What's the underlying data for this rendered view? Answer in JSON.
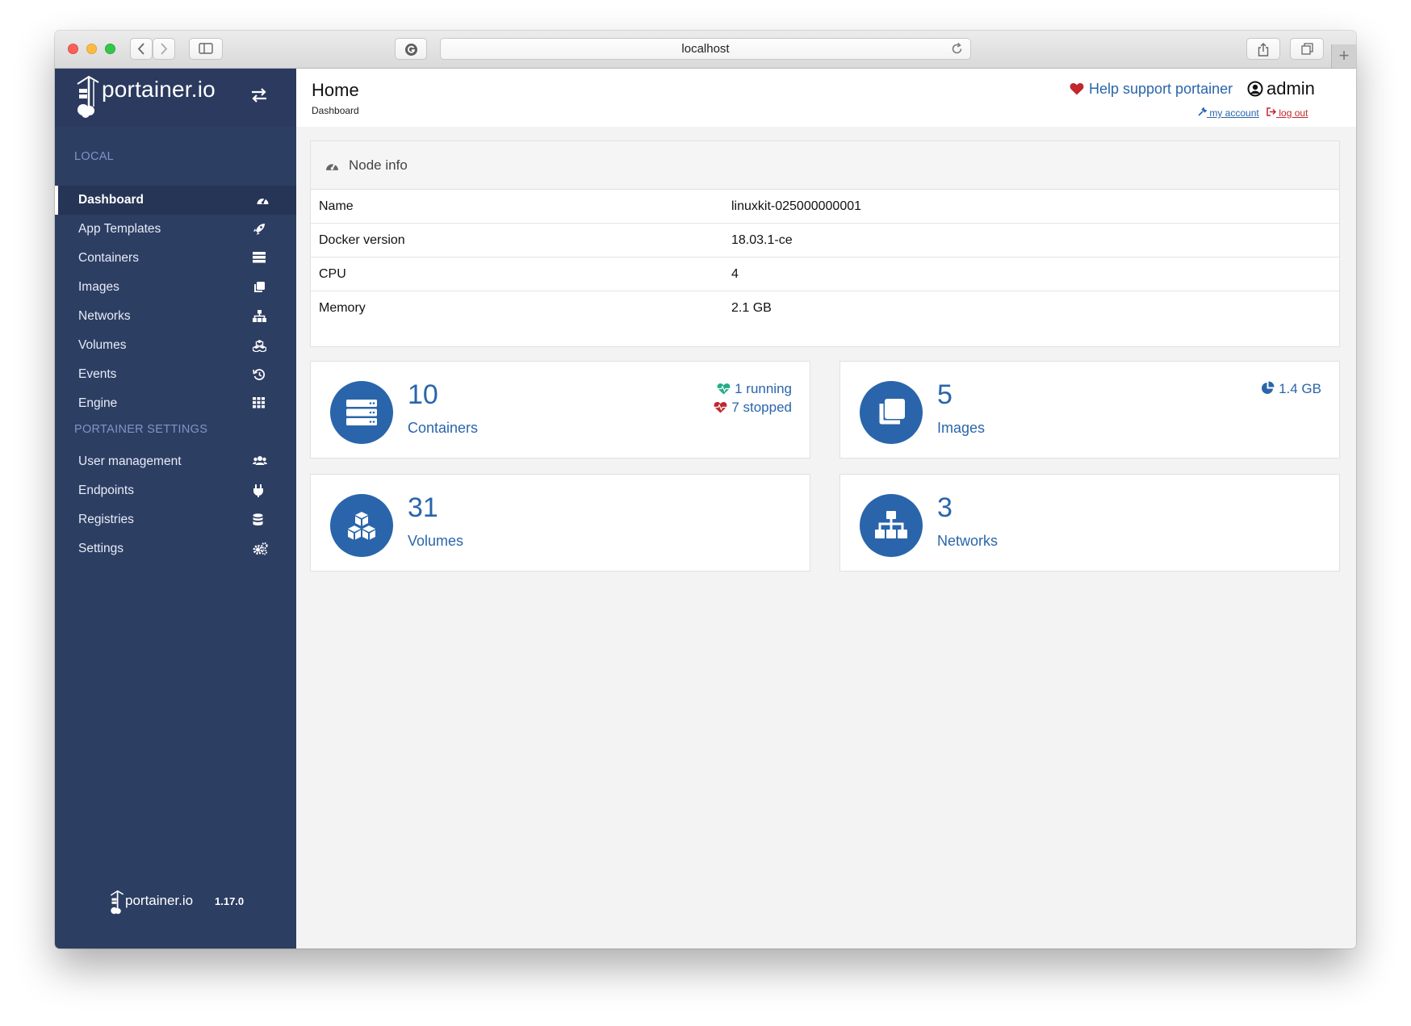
{
  "browser": {
    "url": "localhost",
    "plus_label": "+"
  },
  "sidebar": {
    "logo_text": "portainer.io",
    "sections": [
      {
        "title": "LOCAL"
      },
      {
        "title": "PORTAINER SETTINGS"
      }
    ],
    "items": [
      {
        "label": "Dashboard",
        "icon": "tachometer-icon"
      },
      {
        "label": "App Templates",
        "icon": "rocket-icon"
      },
      {
        "label": "Containers",
        "icon": "server-icon"
      },
      {
        "label": "Images",
        "icon": "clone-icon"
      },
      {
        "label": "Networks",
        "icon": "sitemap-icon"
      },
      {
        "label": "Volumes",
        "icon": "cubes-icon"
      },
      {
        "label": "Events",
        "icon": "history-icon"
      },
      {
        "label": "Engine",
        "icon": "th-icon"
      },
      {
        "label": "User management",
        "icon": "users-icon"
      },
      {
        "label": "Endpoints",
        "icon": "plug-icon"
      },
      {
        "label": "Registries",
        "icon": "database-icon"
      },
      {
        "label": "Settings",
        "icon": "cogs-icon"
      }
    ],
    "footer": {
      "logo_text": "portainer.io",
      "version": "1.17.0"
    }
  },
  "header": {
    "title": "Home",
    "breadcrumb": "Dashboard",
    "help_link": "Help support portainer",
    "username": "admin",
    "my_account": "my account",
    "log_out": "log out"
  },
  "node_info": {
    "title": "Node info",
    "rows": [
      {
        "key": "Name",
        "value": "linuxkit-025000000001"
      },
      {
        "key": "Docker version",
        "value": "18.03.1-ce"
      },
      {
        "key": "CPU",
        "value": "4"
      },
      {
        "key": "Memory",
        "value": "2.1 GB"
      }
    ]
  },
  "stats": {
    "containers": {
      "count": "10",
      "label": "Containers",
      "running": "1 running",
      "stopped": "7 stopped"
    },
    "images": {
      "count": "5",
      "label": "Images",
      "size": "1.4 GB"
    },
    "volumes": {
      "count": "31",
      "label": "Volumes"
    },
    "networks": {
      "count": "3",
      "label": "Networks"
    }
  },
  "colors": {
    "sidebar_bg": "#2d3e63",
    "accent": "#2a65ab",
    "heart_red": "#c0282d",
    "running_green": "#23ae89"
  }
}
